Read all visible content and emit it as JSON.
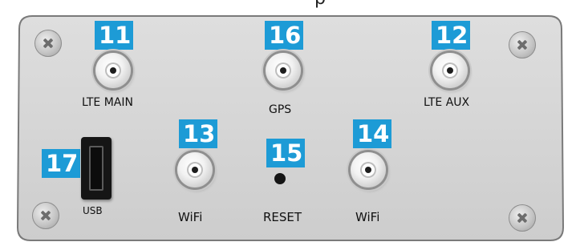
{
  "colors": {
    "panel_fill": "#d4d4d4",
    "panel_stroke": "#7a7a7a",
    "badge": "#1d9bd6",
    "badge_text": "#ffffff",
    "label_text": "#111111"
  },
  "ports": [
    {
      "badge": "11",
      "label": "LTE MAIN"
    },
    {
      "badge": "16",
      "label": "GPS"
    },
    {
      "badge": "12",
      "label": "LTE AUX"
    },
    {
      "badge": "13",
      "label": "WiFi"
    },
    {
      "badge": "15",
      "label": "RESET"
    },
    {
      "badge": "14",
      "label": "WiFi"
    },
    {
      "badge": "17",
      "label": "USB"
    }
  ],
  "title_fragment": "p"
}
